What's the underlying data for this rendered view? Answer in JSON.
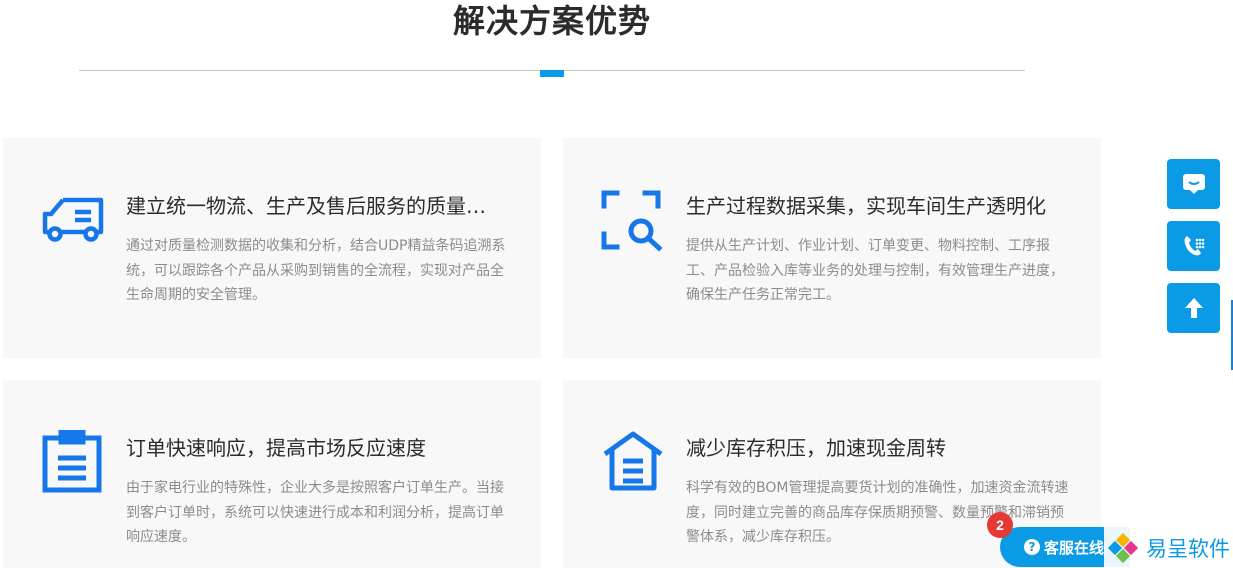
{
  "section": {
    "title": "解决方案优势"
  },
  "cards": [
    {
      "icon": "truck-icon",
      "title": "建立统一物流、生产及售后服务的质量…",
      "desc": "通过对质量检测数据的收集和分析，结合UDP精益条码追溯系统，可以跟踪各个产品从采购到销售的全流程，实现对产品全生命周期的安全管理。"
    },
    {
      "icon": "scan-search-icon",
      "title": "生产过程数据采集，实现车间生产透明化",
      "desc": "提供从生产计划、作业计划、订单变更、物料控制、工序报工、产品检验入库等业务的处理与控制，有效管理生产进度，确保生产任务正常完工。"
    },
    {
      "icon": "clipboard-icon",
      "title": "订单快速响应，提高市场反应速度",
      "desc": "由于家电行业的特殊性，企业大多是按照客户订单生产。当接到客户订单时，系统可以快速进行成本和利润分析，提高订单响应速度。"
    },
    {
      "icon": "warehouse-icon",
      "title": "减少库存积压，加速现金周转",
      "desc": "科学有效的BOM管理提高要货计划的准确性，加速资金流转速度，同时建立完善的商品库存保质期预警、数量预警和滞销预警体系，减少库存积压。"
    }
  ],
  "float_bar": {
    "buttons": [
      "message-icon",
      "phone-icon",
      "back-to-top-icon"
    ]
  },
  "service": {
    "label": "客服在线",
    "badge": "2",
    "brand": "易呈软件"
  },
  "colors": {
    "accent": "#0a9ae6",
    "icon_blue": "#1677e8",
    "badge_red": "#e53935"
  }
}
